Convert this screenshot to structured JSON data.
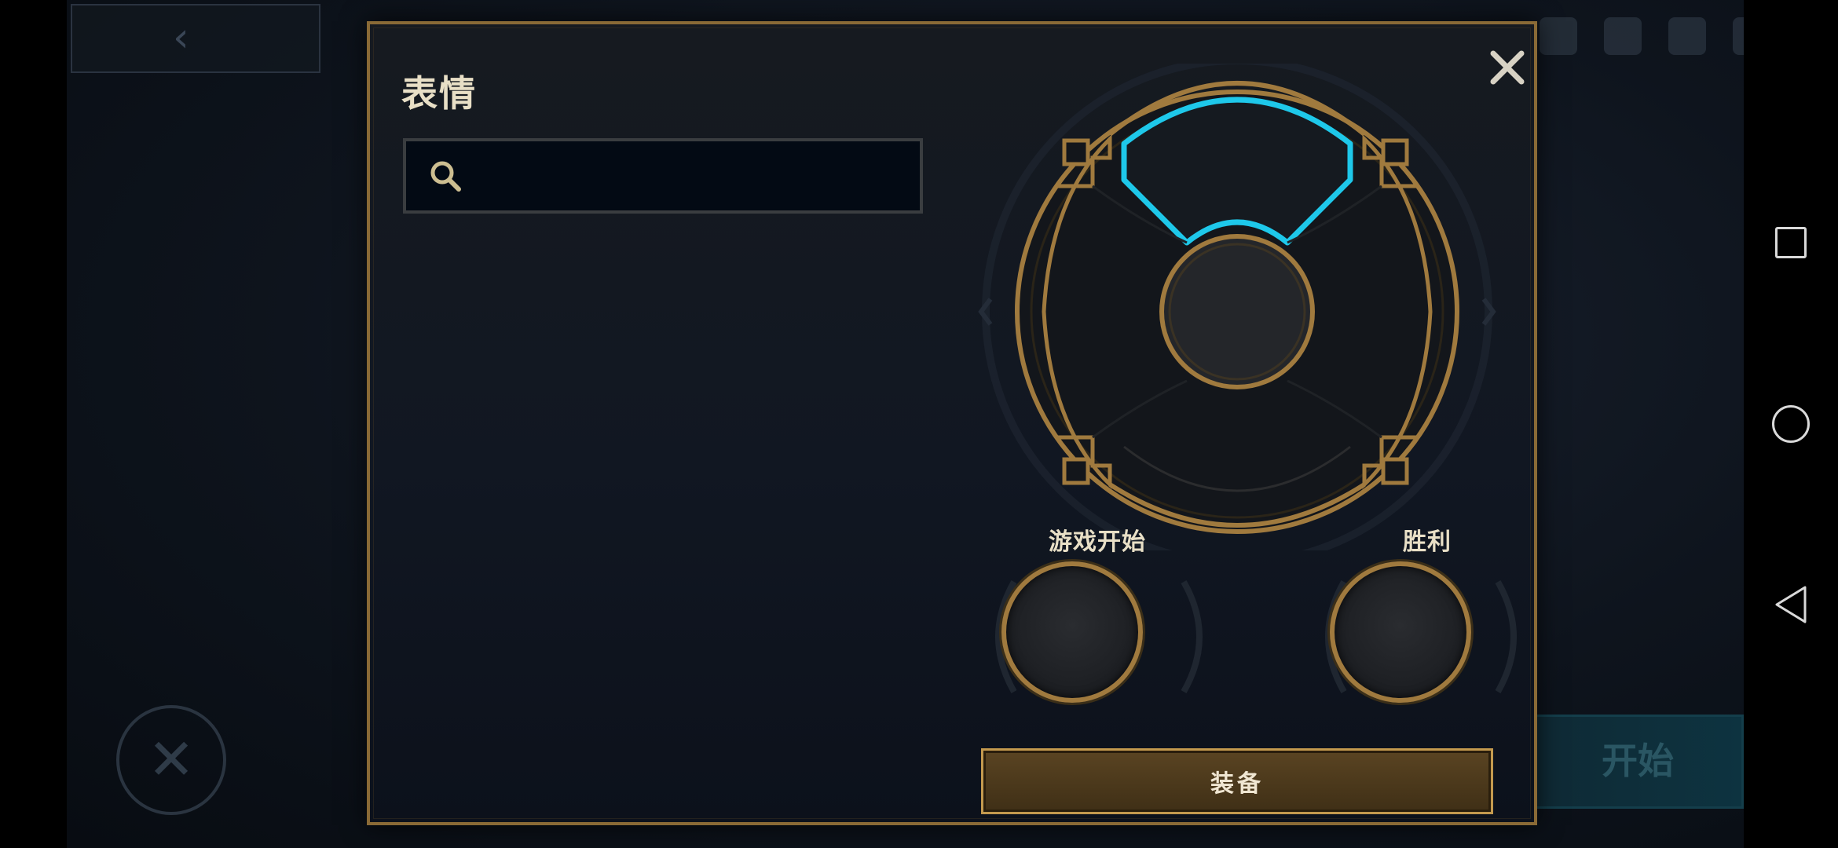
{
  "modal": {
    "title": "表情",
    "search": {
      "value": "",
      "placeholder": ""
    },
    "slots": [
      {
        "label": "游戏开始"
      },
      {
        "label": "胜利"
      }
    ],
    "equip_label": "装备"
  },
  "background": {
    "start_label": "开始"
  },
  "colors": {
    "gold": "#a07a3e",
    "gold_border": "#8a6a36",
    "selected_cyan": "#1ec8ea",
    "modal_bg": "#111722",
    "text": "#e8dfc6"
  },
  "icons": {
    "close": "close-icon",
    "search": "search-icon",
    "nav_recents": "square-icon",
    "nav_home": "circle-icon",
    "nav_back": "triangle-back-icon"
  }
}
